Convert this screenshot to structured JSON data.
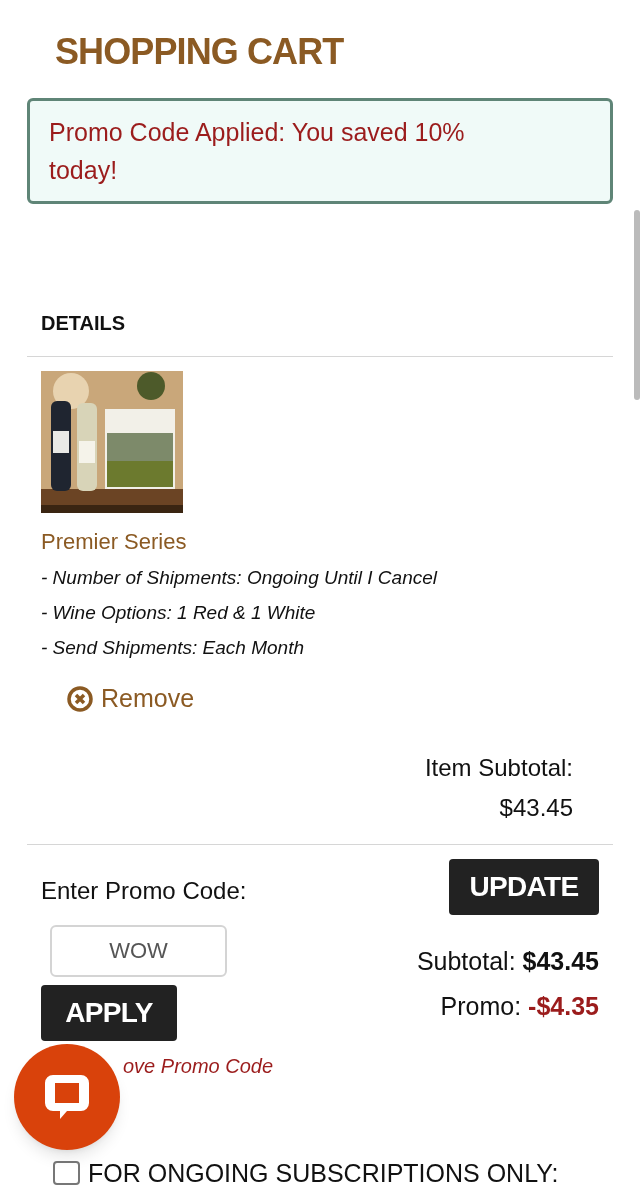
{
  "page": {
    "title": "SHOPPING CART"
  },
  "alert": {
    "message": "Promo Code Applied: You saved 10% today!"
  },
  "details": {
    "heading": "DETAILS"
  },
  "cart_items": [
    {
      "name": "Premier Series",
      "options": [
        "- Number of Shipments: Ongoing Until I Cancel",
        "- Wine Options: 1 Red & 1 White",
        "- Send Shipments: Each Month"
      ],
      "remove_label": "Remove",
      "subtotal_label": "Item Subtotal:",
      "subtotal": "$43.45"
    }
  ],
  "promo": {
    "label": "Enter Promo Code:",
    "code_value": "WOW",
    "apply_label": "APPLY",
    "remove_label": "ove Promo Code"
  },
  "update_label": "UPDATE",
  "totals": {
    "subtotal_label": "Subtotal:",
    "subtotal": "$43.45",
    "promo_label": "Promo:",
    "promo": "-$4.35"
  },
  "subscription_option": {
    "label": "FOR ONGOING SUBSCRIPTIONS ONLY:",
    "checked": false
  }
}
